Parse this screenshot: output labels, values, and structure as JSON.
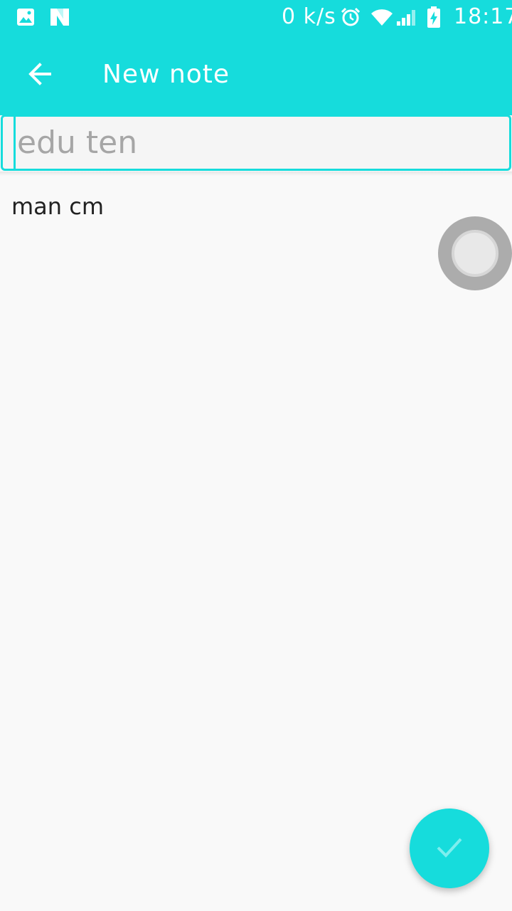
{
  "status_bar": {
    "speed": "0 k/s",
    "time": "18:17",
    "icons": [
      "image-icon",
      "n-icon",
      "alarm-icon",
      "wifi-icon",
      "signal-icon",
      "battery-charging-icon"
    ]
  },
  "toolbar": {
    "title": "New note",
    "back_icon": "arrow-left-icon"
  },
  "title_input": {
    "placeholder": "edu ten",
    "value": ""
  },
  "note": {
    "text": "man cm"
  },
  "fab": {
    "icon": "check-icon"
  },
  "colors": {
    "accent": "#16dcdc",
    "background": "#f9f9f9"
  }
}
